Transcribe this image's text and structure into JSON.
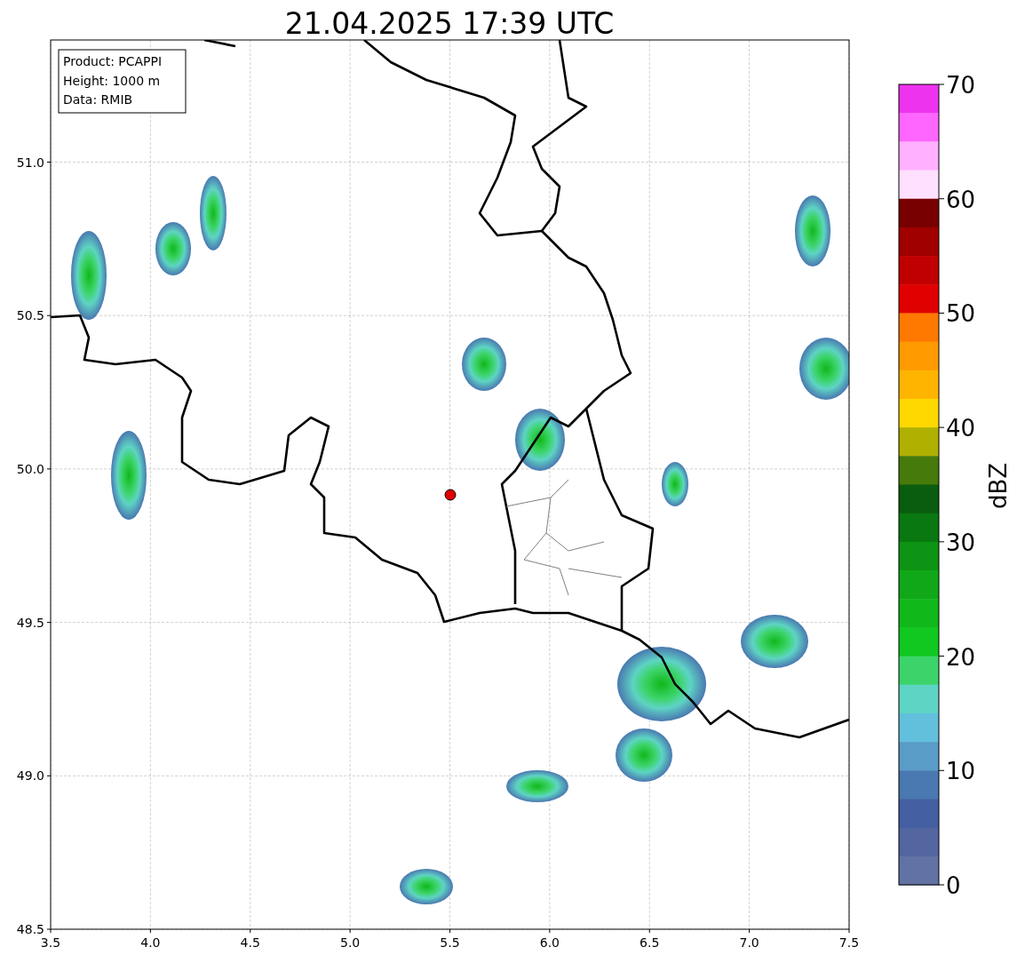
{
  "title": "21.04.2025 17:39 UTC",
  "info_box": [
    "Product: PCAPPI",
    "Height: 1000 m",
    "Data: RMIB"
  ],
  "map": {
    "xticks": [
      "3.5",
      "4.0",
      "4.5",
      "5.0",
      "5.5",
      "6.0",
      "6.5",
      "7.0",
      "7.5"
    ],
    "yticks": [
      "51.0",
      "50.5",
      "50.0",
      "49.5",
      "49.0",
      "48.5"
    ]
  },
  "colorbar": {
    "label": "dBZ",
    "ticks": [
      "70",
      "60",
      "50",
      "40",
      "30",
      "20",
      "10",
      "0"
    ],
    "segments": [
      {
        "color": "#ee33ee"
      },
      {
        "color": "#ff66ff"
      },
      {
        "color": "#ffb0ff"
      },
      {
        "color": "#ffe0ff"
      },
      {
        "color": "#780000"
      },
      {
        "color": "#a00000"
      },
      {
        "color": "#c00000"
      },
      {
        "color": "#e00000"
      },
      {
        "color": "#ff7800"
      },
      {
        "color": "#ff9a00"
      },
      {
        "color": "#ffb400"
      },
      {
        "color": "#ffd800"
      },
      {
        "color": "#b0b000"
      },
      {
        "color": "#467a0a"
      },
      {
        "color": "#0a5c0e"
      },
      {
        "color": "#0a7810"
      },
      {
        "color": "#0e9414"
      },
      {
        "color": "#10a818"
      },
      {
        "color": "#10b81a"
      },
      {
        "color": "#10c820"
      },
      {
        "color": "#3cd46a"
      },
      {
        "color": "#5ed4c4"
      },
      {
        "color": "#62c0dc"
      },
      {
        "color": "#5a9cc8"
      },
      {
        "color": "#4a78b0"
      },
      {
        "color": "#4460a3"
      },
      {
        "color": "#5366a0"
      },
      {
        "color": "#6272a4"
      }
    ]
  }
}
